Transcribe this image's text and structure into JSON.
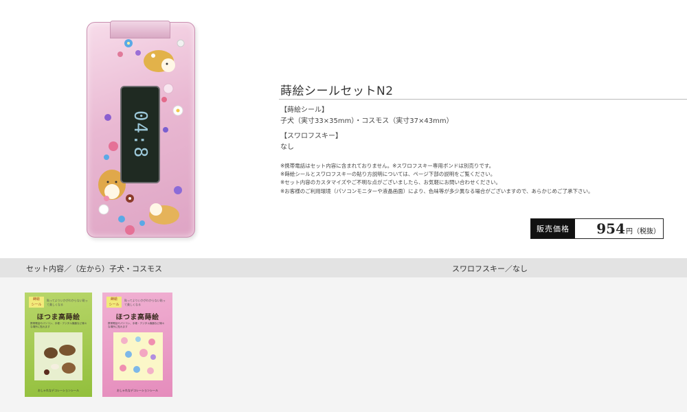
{
  "product": {
    "title": "蒔絵シールセットN2",
    "phone_time": "04:8",
    "spec": {
      "seal_label": "【蒔絵シール】",
      "seal_value": "子犬（実寸33×35mm）・コスモス（実寸37×43mm）",
      "swarovski_label": "【スワロフスキー】",
      "swarovski_value": "なし"
    },
    "notes": [
      "※携帯電話はセット内容に含まれておりません。※スワロフスキー専用ボンドは別売りです。",
      "※蒔絵シールとスワロフスキーの貼り方説明については、ページ下部の説明をご覧ください。",
      "※セット内容のカスタマイズやご不明な点がございましたら、お気軽にお問い合わせください。",
      "※お客様のご利用環境（パソコンモニターや液晶画面）により、色味等が多少異なる場合がございますので、あらかじめご了承下さい。"
    ],
    "price": {
      "label": "販売価格",
      "value": "954",
      "unit": "円（税抜）"
    }
  },
  "band": {
    "left_label": "セット内容／（左から）子犬・コスモス",
    "right_label": "スワロフスキー／なし"
  },
  "cards": [
    {
      "badge": "蒔絵\nシール",
      "title": "ほつま高蒔絵",
      "tag": "貼ってよりいかがわからない貼って美しくなる",
      "desc": "携帯電話やパソコン、手帳・デジタル機器など様々な場所に貼れます",
      "foot": "おしゃれなデコレーションシール"
    },
    {
      "badge": "蒔絵\nシール",
      "title": "ほつま高蒔絵",
      "tag": "貼ってよりいかがわからない貼って美しくなる",
      "desc": "携帯電話やパソコン、手帳・デジタル機器など様々な場所に貼れます",
      "foot": "おしゃれなデコレーションシール"
    }
  ],
  "colors": {
    "price_label_bg": "#111111",
    "band_bg": "#e3e3e3",
    "lower_bg": "#f4f4f4",
    "phone_pink": "#e9b8d2",
    "card_green": "#a4ca4e",
    "card_pink": "#ea9dc6"
  }
}
